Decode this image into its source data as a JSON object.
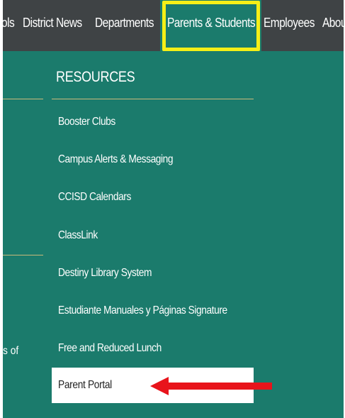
{
  "nav": {
    "items": [
      {
        "label": "ols"
      },
      {
        "label": "District News"
      },
      {
        "label": "Departments"
      },
      {
        "label": "Parents & Students"
      },
      {
        "label": "Employees"
      },
      {
        "label": "Abou"
      }
    ],
    "active_index": 3
  },
  "dropdown": {
    "heading": "RESOURCES",
    "items": [
      {
        "label": "Booster Clubs"
      },
      {
        "label": "Campus Alerts & Messaging"
      },
      {
        "label": "CCISD Calendars"
      },
      {
        "label": "ClassLink"
      },
      {
        "label": "Destiny Library System"
      },
      {
        "label": "Estudiante Manuales y Páginas Signature"
      },
      {
        "label": "Free and Reduced Lunch"
      },
      {
        "label": "Parent Portal"
      }
    ],
    "selected_index": 7
  },
  "side": {
    "partial_text": "s of"
  },
  "colors": {
    "nav_bg": "#3f4345",
    "teal": "#1b7b6c",
    "highlight_border": "#f5ef17",
    "arrow": "#e8141b",
    "divider": "#c9b97a"
  }
}
